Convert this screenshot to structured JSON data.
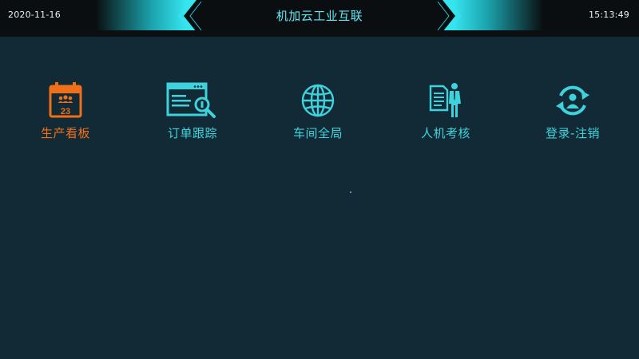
{
  "header": {
    "date": "2020-11-16",
    "title": "机加云工业互联",
    "time": "15:13:49"
  },
  "menu": {
    "items": [
      {
        "label": "生产看板",
        "icon": "calendar-team-icon",
        "active": true
      },
      {
        "label": "订单跟踪",
        "icon": "browser-search-icon",
        "active": false
      },
      {
        "label": "车间全局",
        "icon": "globe-icon",
        "active": false
      },
      {
        "label": "人机考核",
        "icon": "person-document-icon",
        "active": false
      },
      {
        "label": "登录-注销",
        "icon": "user-cycle-icon",
        "active": false
      }
    ]
  },
  "colors": {
    "background": "#112a36",
    "header": "#0a0e10",
    "accent_cyan": "#3ed3dc",
    "active_orange": "#f0701a",
    "text_light": "#e6f2f4"
  },
  "icon_text": {
    "calendar_day": "23"
  }
}
